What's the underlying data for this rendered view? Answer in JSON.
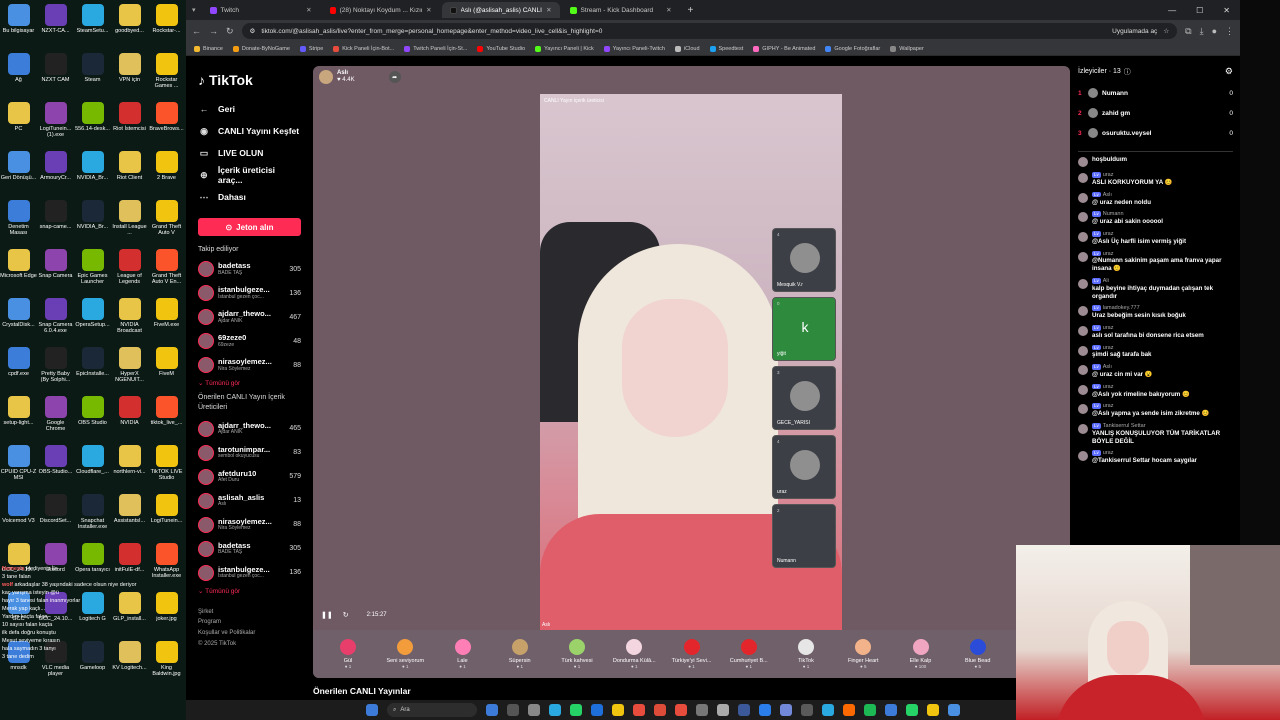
{
  "desktop": {
    "icons": [
      "Bu bilgisayar",
      "NZXT-CA...",
      "SteamSetu...",
      "goodbyed...",
      "Rockstar-...",
      "Ağ",
      "NZXT CAM",
      "Steam",
      "VPN için",
      "Rockstar Games ...",
      "PC",
      "LogiTunein... (1).exe",
      "556.14-desk...",
      "Riot İstemcisi",
      "BraveBrows...",
      "Geri Dönüşü...",
      "ArmouryCr...",
      "NVIDIA_Br...",
      "Riot Client",
      "2 Brave",
      "Denetim Masası",
      "snap-came...",
      "NVIDIA_Br...",
      "Install League ...",
      "Grand Theft Auto V",
      "Microsoft Edge",
      "Snap Camera",
      "Epic Games Launcher",
      "League of Legends",
      "Grand Theft Auto V En...",
      "CrystalDisk...",
      "Snap Camera 6.0.4.exe",
      "OperaSetup...",
      "NVIDIA Broadcast",
      "FiveM.exe",
      "cpdf.exe",
      "Pretty Baby (By Solphi...",
      "EpicInstalle...",
      "HyperX NGENUIT...",
      "FiveM",
      "setup-light...",
      "Google Chrome",
      "OBS Studio",
      "NVIDIA",
      "tiktok_live_...",
      "CPUID CPU-Z MSI",
      "OBS-Studio...",
      "Cloudflare_...",
      "northlern-vi...",
      "TikTOK LIVE Studio",
      "Voicemod V3",
      "DiscordSet...",
      "Snapchat Installer.exe",
      "AssistantsI...",
      "LogiTunein...",
      "GCC_24.10...",
      "Discord",
      "Opera tarayıcı",
      "initFuIE-df...",
      "WhatsApp Installer.exe",
      "GCC",
      "GCC_24.10...",
      "Logitech G",
      "GLP_install...",
      "joker.jpg",
      "mnsdk",
      "VLC media player",
      "Gameloop",
      "KV Logitech...",
      "King Baldwin.jpg"
    ],
    "chat_lines": [
      {
        "u": "Nemesis",
        "t": "Hediyeniz İle"
      },
      {
        "u": "",
        "t": "3 tane falan"
      },
      {
        "u": "wolf",
        "t": "arkadaşlar 38 yaşındaki sadece olsun niye deriyor"
      },
      {
        "u": "",
        "t": "kaç yarışma isteyin @ü"
      },
      {
        "u": "",
        "t": "hayır 3 tanesi falan inanmıyorlar"
      },
      {
        "u": "",
        "t": "Merak yap kaçlı..."
      },
      {
        "u": "",
        "t": "Yardım kaçta falan"
      },
      {
        "u": "",
        "t": "10 sayısı falan kaçta"
      },
      {
        "u": "",
        "t": "ilk defa doğru konuştu"
      },
      {
        "u": "",
        "t": "Mesut seviyeme kırasın"
      },
      {
        "u": "",
        "t": "hala saymadın 3 tanyı"
      },
      {
        "u": "",
        "t": "3 tane dedim"
      }
    ]
  },
  "browser": {
    "tabs": [
      {
        "label": "Twitch",
        "color": "#9146ff"
      },
      {
        "label": "(28) Noktayı Koydum ... Kızın Se",
        "color": "#ff0000"
      },
      {
        "label": "Aslı (@aslisah_aslis) CANLI",
        "color": "#111111"
      },
      {
        "label": "Stream - Kick Dashboard",
        "color": "#53fc18"
      }
    ],
    "url": "tiktok.com/@aslisah_aslis/live?enter_from_merge=personal_homepage&enter_method=video_live_cell&is_highlight=0",
    "app_button": "Uygulamada aç",
    "bookmarks": [
      "Binance",
      "Donate-ByNoGame",
      "Stripe",
      "Kick Paneli İçin-Bot...",
      "Twitch Paneli İçin-St...",
      "YouTube Studio",
      "Yayıncı Paneli | Kick",
      "Yayıncı Paneli-Twitch",
      "iCloud",
      "Speedtest",
      "GIPHY - Be Animated",
      "Google Fotoğraflar",
      "Wallpaper"
    ]
  },
  "tiktok": {
    "logo": "TikTok",
    "nav": [
      {
        "icon": "←",
        "label": "Geri"
      },
      {
        "icon": "◉",
        "label": "CANLI Yayını Keşfet"
      },
      {
        "icon": "▭",
        "label": "LIVE OLUN"
      },
      {
        "icon": "⊕",
        "label": "İçerik üreticisi araç..."
      },
      {
        "icon": "⋯",
        "label": "Dahası"
      }
    ],
    "coin_button": "Jeton alın",
    "following_title": "Takip ediliyor",
    "following": [
      {
        "name": "badetass",
        "sub": "BADE TAŞ",
        "count": "305"
      },
      {
        "name": "istanbulgeze...",
        "sub": "İstanbul gezen çoc...",
        "count": "136"
      },
      {
        "name": "ajdarr_thewo...",
        "sub": "Ajdar ANIK",
        "count": "467"
      },
      {
        "name": "69zeze0",
        "sub": "69zeze",
        "count": "48"
      },
      {
        "name": "nirasoylemez...",
        "sub": "Nira Söylemez",
        "count": "88"
      }
    ],
    "see_all": "Tümünü gör",
    "suggested_title": "Önerilen CANLI Yayın İçerik Üreticileri",
    "suggested": [
      {
        "name": "ajdarr_thewo...",
        "sub": "Ajdar ANIK",
        "count": "465"
      },
      {
        "name": "tarotunimpar...",
        "sub": "sembol okuyucusu",
        "count": "83"
      },
      {
        "name": "afetduru10",
        "sub": "Afet Duru",
        "count": "579"
      },
      {
        "name": "aslisah_aslis",
        "sub": "Aslı",
        "count": "13"
      },
      {
        "name": "nirasoylemez...",
        "sub": "Nira Söylemez",
        "count": "88"
      },
      {
        "name": "badetass",
        "sub": "BADE TAŞ",
        "count": "305"
      },
      {
        "name": "istanbulgeze...",
        "sub": "İstanbul gezen çoc...",
        "count": "136"
      }
    ],
    "see_all2": "Tümünü gör",
    "footer": [
      "Şirket",
      "Program",
      "Koşullar ve Politikalar",
      "© 2025 TikTok"
    ],
    "host_name": "Aslı",
    "host_likes": "4.4K",
    "video_label": "CANLI Yayın içerik üreticisi",
    "video_corner": "Aslı",
    "time": "2:15:27",
    "guests": [
      {
        "name": "Mesquik V.r",
        "info": "4"
      },
      {
        "name": "yiğit",
        "info": "0",
        "letter": "k"
      },
      {
        "name": "GECE_YARISI",
        "info": "3"
      },
      {
        "name": "uraz",
        "info": "4"
      },
      {
        "name": "Numann",
        "info": "2"
      }
    ],
    "gifts": [
      {
        "name": "Gül",
        "price": "1",
        "color": "#e83e6c"
      },
      {
        "name": "Seni seviyorum",
        "price": "1",
        "color": "#f39c3c"
      },
      {
        "name": "Lale",
        "price": "1",
        "color": "#ff7eb6"
      },
      {
        "name": "Süpersin",
        "price": "1",
        "color": "#c7a16a"
      },
      {
        "name": "Türk kahvesi",
        "price": "1",
        "color": "#9bd36a"
      },
      {
        "name": "Dondurma Külâ...",
        "price": "1",
        "color": "#f4d6e0"
      },
      {
        "name": "Türkiye'yi Sevi...",
        "price": "1",
        "color": "#e3262b"
      },
      {
        "name": "Cumhuriyet B...",
        "price": "1",
        "color": "#e3262b"
      },
      {
        "name": "TikTok",
        "price": "1",
        "color": "#e6e6e6"
      },
      {
        "name": "Finger Heart",
        "price": "5",
        "color": "#f3b38a"
      },
      {
        "name": "Elle Kalp",
        "price": "100",
        "color": "#f0a6c0"
      },
      {
        "name": "Blue Bead",
        "price": "5",
        "color": "#2a4cd8"
      },
      {
        "name": "More",
        "price": "",
        "color": "#888888"
      }
    ],
    "below_title": "Önerilen CANLI Yayınlar",
    "viewers_title": "İzleyiciler · 13",
    "top_viewers": [
      {
        "rank": "1",
        "name": "Numann",
        "score": "0"
      },
      {
        "rank": "2",
        "name": "zahid gm",
        "score": "0"
      },
      {
        "rank": "3",
        "name": "osuruktu.veysel",
        "score": "0"
      }
    ],
    "messages": [
      {
        "user": "",
        "text": "hoşbulduım"
      },
      {
        "user": "uraz",
        "text": "ASLI KORKUYORUM YA 😊"
      },
      {
        "user": "Aslı",
        "text": "@ uraz neden noldu"
      },
      {
        "user": "Numann",
        "text": "@ uraz abi sakin oooool"
      },
      {
        "user": "uraz",
        "text": "@Aslı Üç harfli isim vermiş yiğit"
      },
      {
        "user": "uraz",
        "text": "@Numann sakinim paşam ama franva yapar insana 🙂"
      },
      {
        "user": "Ali",
        "text": "kalp beyine ihtiyaç duymadan çalışan tek organdır"
      },
      {
        "user": "lamadokey.777",
        "text": "Uraz bebeğim sesin kısık boğuk"
      },
      {
        "user": "uraz",
        "text": "aslı sol tarafına bi donsene rica etsem"
      },
      {
        "user": "uraz",
        "text": "şimdi sağ tarafa bak"
      },
      {
        "user": "Aslı",
        "text": "@ uraz cin mi var 😮"
      },
      {
        "user": "uraz",
        "text": "@Aslı yok rimeline bakıyorum 😊"
      },
      {
        "user": "uraz",
        "text": "@Aslı yapma ya sende isim zikretme 😊"
      },
      {
        "user": "Tankiserrul Settar",
        "text": "YANLIŞ KONUŞULUYOR TÜM TARİKATLAR BÖYLE DEĞİL"
      },
      {
        "user": "uraz",
        "text": "@Tankiserrul Settar hocam saygılar"
      }
    ]
  },
  "taskbar": {
    "search": "Ara",
    "icons": [
      "#3d7bd9",
      "#555",
      "#888",
      "#2aa9e0",
      "#25d366",
      "#1e6fd9",
      "#f1c40f",
      "#e74c3c",
      "#dd4b39",
      "#e84c3d",
      "#777",
      "#aaa",
      "#3b5998",
      "#2b7de9",
      "#7289da",
      "#5a5a5a",
      "#2aa9e0",
      "#ff6a00",
      "#1db954",
      "#3d7bd9",
      "#25d366",
      "#f1c40f",
      "#4a90e2"
    ]
  }
}
